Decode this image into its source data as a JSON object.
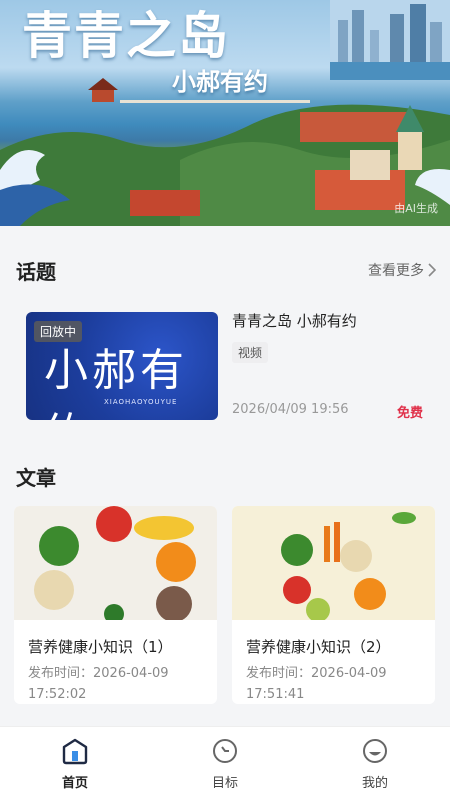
{
  "hero": {
    "title": "青青之岛",
    "subtitle": "小郝有约",
    "ai_label": "由AI生成"
  },
  "topics": {
    "heading": "话题",
    "more_label": "查看更多",
    "card": {
      "badge": "回放中",
      "thumb_text": "小郝有约",
      "thumb_subtext": "XIAOHAOYOUYUE",
      "title": "青青之岛 小郝有约",
      "tag": "视频",
      "date": "2026/04/09 19:56",
      "price": "免费"
    }
  },
  "articles": {
    "heading": "文章",
    "items": [
      {
        "title": "营养健康小知识（1）",
        "publish": "发布时间：2026-04-09 17:52:02"
      },
      {
        "title": "营养健康小知识（2）",
        "publish": "发布时间：2026-04-09 17:51:41"
      }
    ]
  },
  "tabbar": {
    "items": [
      {
        "label": "首页",
        "icon": "home-icon"
      },
      {
        "label": "目标",
        "icon": "target-icon"
      },
      {
        "label": "我的",
        "icon": "profile-icon"
      }
    ]
  },
  "colors": {
    "accent": "#e0324b",
    "hero_sky": "#9ec8e6",
    "thumb_blue": "#1c3d9c"
  }
}
